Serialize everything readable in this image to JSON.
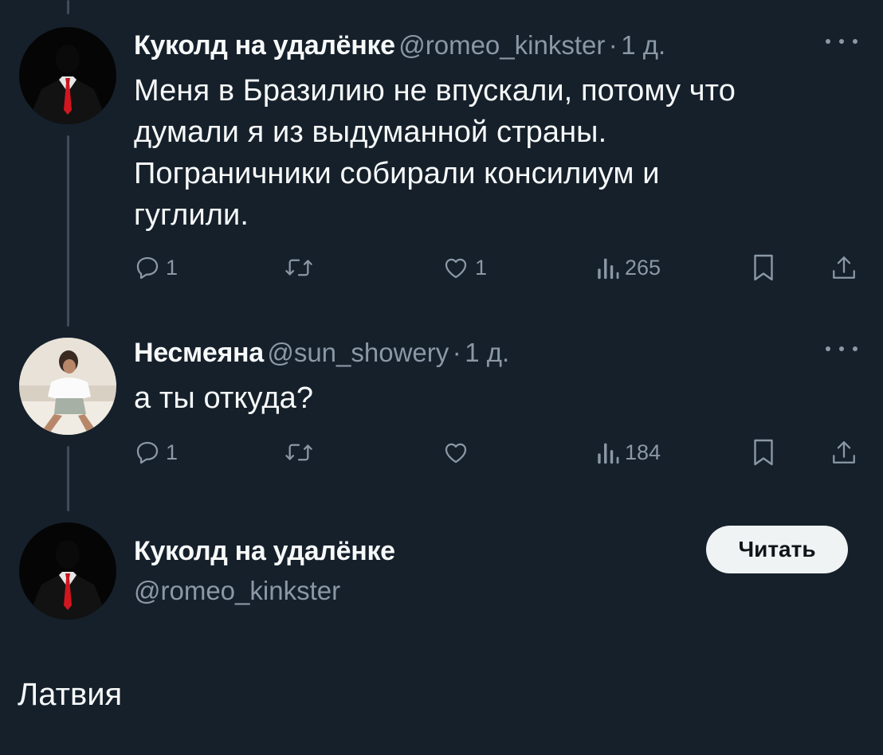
{
  "posts": [
    {
      "author_name": "Куколд на удалёнке",
      "handle": "@romeo_kinkster",
      "separator": "·",
      "time": "1 д.",
      "lines": [
        "Меня в Бразилию не впускали, потому что",
        "думали я из выдуманной страны.",
        "Пограничники собирали консилиум и",
        "гуглили."
      ],
      "reply_count": "1",
      "repost_count": "",
      "like_count": "1",
      "view_count": "265"
    },
    {
      "author_name": "Несмеяна",
      "handle": "@sun_showery",
      "separator": "·",
      "time": "1 д.",
      "lines": [
        "а ты откуда?"
      ],
      "reply_count": "1",
      "repost_count": "",
      "like_count": "",
      "view_count": "184"
    }
  ],
  "profile_card": {
    "name": "Куколд на удалёнке",
    "handle": "@romeo_kinkster",
    "follow_label": "Читать"
  },
  "reply": {
    "text": "Латвия"
  },
  "icons": [
    "reply-icon",
    "repost-icon",
    "like-icon",
    "views-icon",
    "bookmark-icon",
    "share-icon",
    "more-icon"
  ],
  "colors": {
    "background": "#15202b",
    "text": "#f7f9f9",
    "secondary": "#8b98a5",
    "thread_line": "#3e4c5a",
    "button": "#eff3f4"
  }
}
